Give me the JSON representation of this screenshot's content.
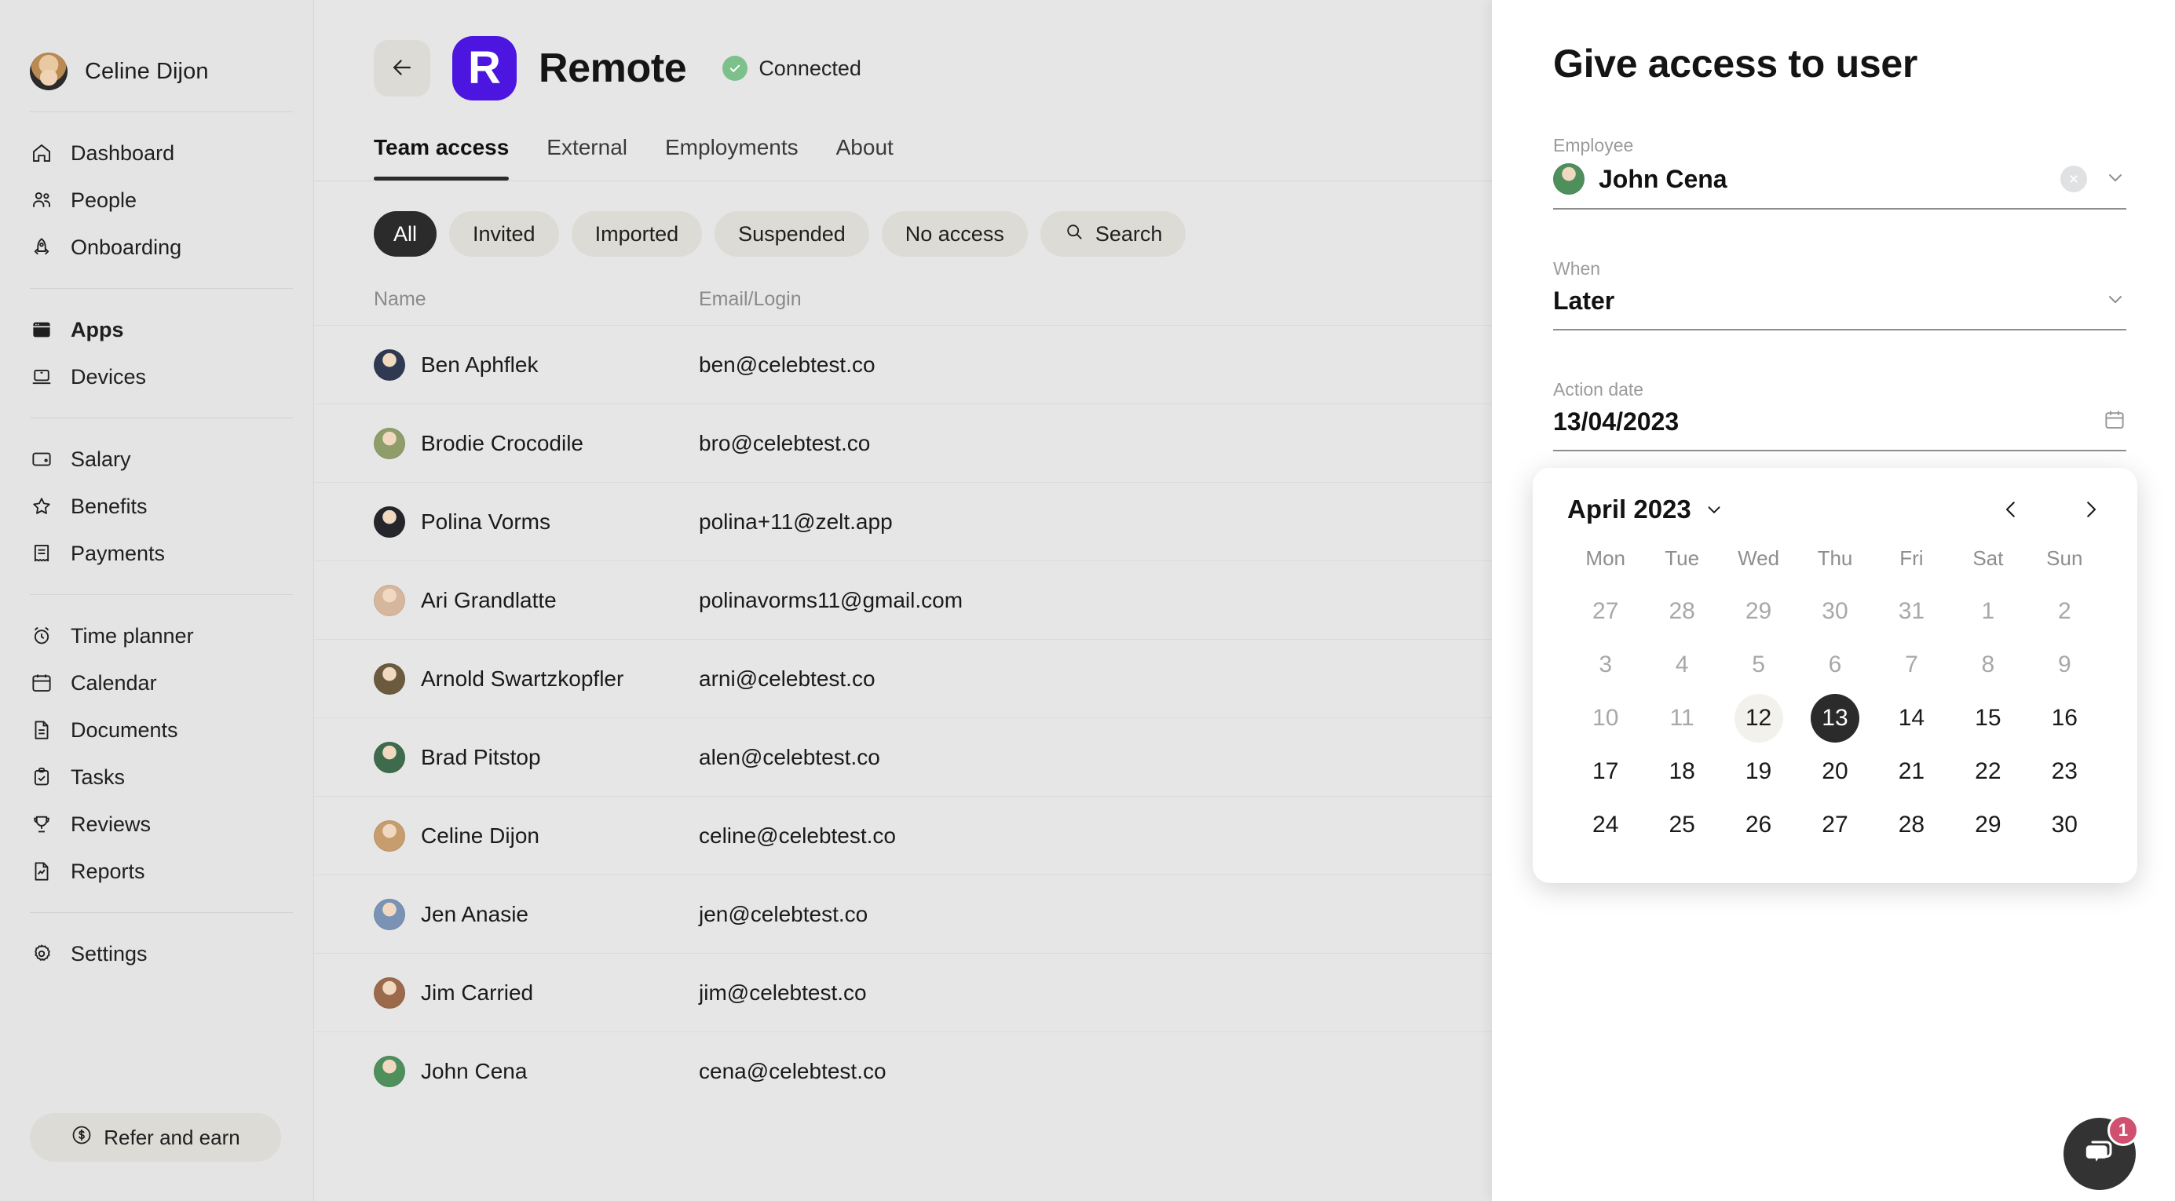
{
  "sidebar": {
    "user": {
      "name": "Celine Dijon"
    },
    "groups": [
      {
        "items": [
          {
            "label": "Dashboard",
            "icon": "home-icon",
            "active": false
          },
          {
            "label": "People",
            "icon": "people-icon",
            "active": false
          },
          {
            "label": "Onboarding",
            "icon": "rocket-icon",
            "active": false
          }
        ]
      },
      {
        "items": [
          {
            "label": "Apps",
            "icon": "apps-icon",
            "active": true
          },
          {
            "label": "Devices",
            "icon": "laptop-icon",
            "active": false
          }
        ]
      },
      {
        "items": [
          {
            "label": "Salary",
            "icon": "wallet-icon",
            "active": false
          },
          {
            "label": "Benefits",
            "icon": "star-icon",
            "active": false
          },
          {
            "label": "Payments",
            "icon": "receipt-icon",
            "active": false
          }
        ]
      },
      {
        "items": [
          {
            "label": "Time planner",
            "icon": "alarm-clock-icon",
            "active": false
          },
          {
            "label": "Calendar",
            "icon": "calendar-icon",
            "active": false
          },
          {
            "label": "Documents",
            "icon": "document-icon",
            "active": false
          },
          {
            "label": "Tasks",
            "icon": "clipboard-check-icon",
            "active": false
          },
          {
            "label": "Reviews",
            "icon": "trophy-icon",
            "active": false
          },
          {
            "label": "Reports",
            "icon": "report-chart-icon",
            "active": false
          }
        ]
      },
      {
        "items": [
          {
            "label": "Settings",
            "icon": "gear-icon",
            "active": false
          }
        ]
      }
    ],
    "refer": {
      "label": "Refer and earn",
      "icon": "dollar-circle-icon"
    }
  },
  "header": {
    "back_icon": "arrow-left-icon",
    "logo_letter": "R",
    "logo_color": "#4d16e0",
    "title": "Remote",
    "status": "Connected",
    "status_color": "#7cc08a",
    "close_icon": "close-icon"
  },
  "tabs": [
    {
      "label": "Team access",
      "active": true
    },
    {
      "label": "External",
      "active": false
    },
    {
      "label": "Employments",
      "active": false
    },
    {
      "label": "About",
      "active": false
    }
  ],
  "filters": [
    {
      "label": "All",
      "active": true
    },
    {
      "label": "Invited",
      "active": false
    },
    {
      "label": "Imported",
      "active": false
    },
    {
      "label": "Suspended",
      "active": false
    },
    {
      "label": "No access",
      "active": false
    }
  ],
  "search_pill": {
    "label": "Search",
    "icon": "search-icon"
  },
  "table": {
    "columns": [
      "Name",
      "Email/Login"
    ],
    "rows": [
      {
        "name": "Ben Aphflek",
        "email": "ben@celebtest.co",
        "avatar": "#2f3a52"
      },
      {
        "name": "Brodie Crocodile",
        "email": "bro@celebtest.co",
        "avatar": "#8f9d6a"
      },
      {
        "name": "Polina Vorms",
        "email": "polina+11@zelt.app",
        "avatar": "#24262b"
      },
      {
        "name": "Ari Grandlatte",
        "email": "polinavorms11@gmail.com",
        "avatar": "#d6b79e"
      },
      {
        "name": "Arnold Swartzkopfler",
        "email": "arni@celebtest.co",
        "avatar": "#6b5a3e"
      },
      {
        "name": "Brad Pitstop",
        "email": "alen@celebtest.co",
        "avatar": "#3e6b4c"
      },
      {
        "name": "Celine Dijon",
        "email": "celine@celebtest.co",
        "avatar": "#c79d6e"
      },
      {
        "name": "Jen Anasie",
        "email": "jen@celebtest.co",
        "avatar": "#7a93b5"
      },
      {
        "name": "Jim Carried",
        "email": "jim@celebtest.co",
        "avatar": "#9a6a4b"
      },
      {
        "name": "John Cena",
        "email": "cena@celebtest.co",
        "avatar": "#4e8f5c"
      }
    ]
  },
  "panel": {
    "title": "Give access to user",
    "employee": {
      "label": "Employee",
      "value": "John Cena",
      "avatar": "#4e8f5c",
      "clear_icon": "clear-circle-icon",
      "chevron_icon": "chevron-down-icon"
    },
    "when": {
      "label": "When",
      "value": "Later",
      "chevron_icon": "chevron-down-icon"
    },
    "action_date": {
      "label": "Action date",
      "value": "13/04/2023",
      "calendar_icon": "calendar-icon"
    },
    "submit_color": "#eac572"
  },
  "calendar": {
    "month_label": "April 2023",
    "month_chevron_icon": "chevron-down-icon",
    "prev_icon": "chevron-left-icon",
    "next_icon": "chevron-right-icon",
    "weekdays": [
      "Mon",
      "Tue",
      "Wed",
      "Thu",
      "Fri",
      "Sat",
      "Sun"
    ],
    "days": [
      {
        "n": "27",
        "state": "muted"
      },
      {
        "n": "28",
        "state": "muted"
      },
      {
        "n": "29",
        "state": "muted"
      },
      {
        "n": "30",
        "state": "muted"
      },
      {
        "n": "31",
        "state": "muted"
      },
      {
        "n": "1",
        "state": "muted"
      },
      {
        "n": "2",
        "state": "muted"
      },
      {
        "n": "3",
        "state": "muted"
      },
      {
        "n": "4",
        "state": "muted"
      },
      {
        "n": "5",
        "state": "muted"
      },
      {
        "n": "6",
        "state": "muted"
      },
      {
        "n": "7",
        "state": "muted"
      },
      {
        "n": "8",
        "state": "muted"
      },
      {
        "n": "9",
        "state": "muted"
      },
      {
        "n": "10",
        "state": "muted"
      },
      {
        "n": "11",
        "state": "muted"
      },
      {
        "n": "12",
        "state": "today"
      },
      {
        "n": "13",
        "state": "sel"
      },
      {
        "n": "14",
        "state": ""
      },
      {
        "n": "15",
        "state": ""
      },
      {
        "n": "16",
        "state": ""
      },
      {
        "n": "17",
        "state": ""
      },
      {
        "n": "18",
        "state": ""
      },
      {
        "n": "19",
        "state": ""
      },
      {
        "n": "20",
        "state": ""
      },
      {
        "n": "21",
        "state": ""
      },
      {
        "n": "22",
        "state": ""
      },
      {
        "n": "23",
        "state": ""
      },
      {
        "n": "24",
        "state": ""
      },
      {
        "n": "25",
        "state": ""
      },
      {
        "n": "26",
        "state": ""
      },
      {
        "n": "27",
        "state": ""
      },
      {
        "n": "28",
        "state": ""
      },
      {
        "n": "29",
        "state": ""
      },
      {
        "n": "30",
        "state": ""
      }
    ]
  },
  "chat": {
    "icon": "chat-bubble-icon",
    "badge": "1",
    "badge_color": "#d0516f"
  }
}
